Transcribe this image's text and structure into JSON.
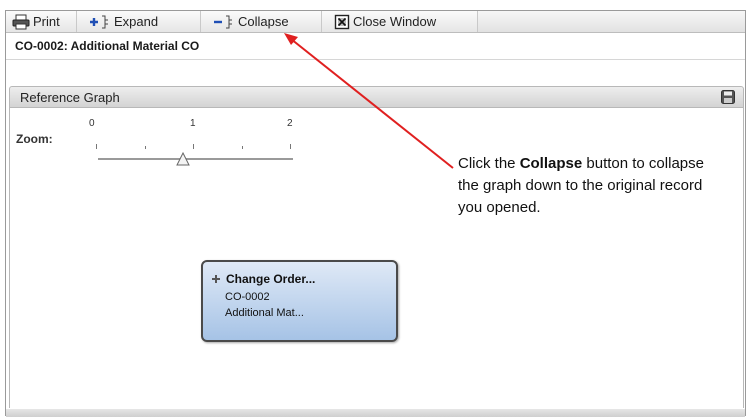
{
  "toolbar": {
    "print_label": "Print",
    "expand_label": "Expand",
    "collapse_label": "Collapse",
    "close_label": "Close Window"
  },
  "record_title": "CO-0002: Additional Material CO",
  "panel": {
    "title": "Reference Graph"
  },
  "zoom": {
    "label": "Zoom:",
    "ticks": [
      "0",
      "1",
      "2"
    ],
    "value": 0.9,
    "min": 0,
    "max": 2
  },
  "node": {
    "title": "Change Order...",
    "id": "CO-0002",
    "description": "Additional Mat..."
  },
  "callout": {
    "before": "Click the ",
    "emphasis": "Collapse",
    "after": " button to collapse the graph down to the original record you opened."
  },
  "colors": {
    "accent_blue": "#1f4fb5",
    "arrow": "#e02020",
    "node_fill": "#a6c3e6"
  },
  "icons": {
    "print": "printer-icon",
    "expand": "expand-tree-icon",
    "collapse": "collapse-tree-icon",
    "close": "close-window-icon",
    "panel": "save-icon",
    "node": "expand-node-icon"
  }
}
